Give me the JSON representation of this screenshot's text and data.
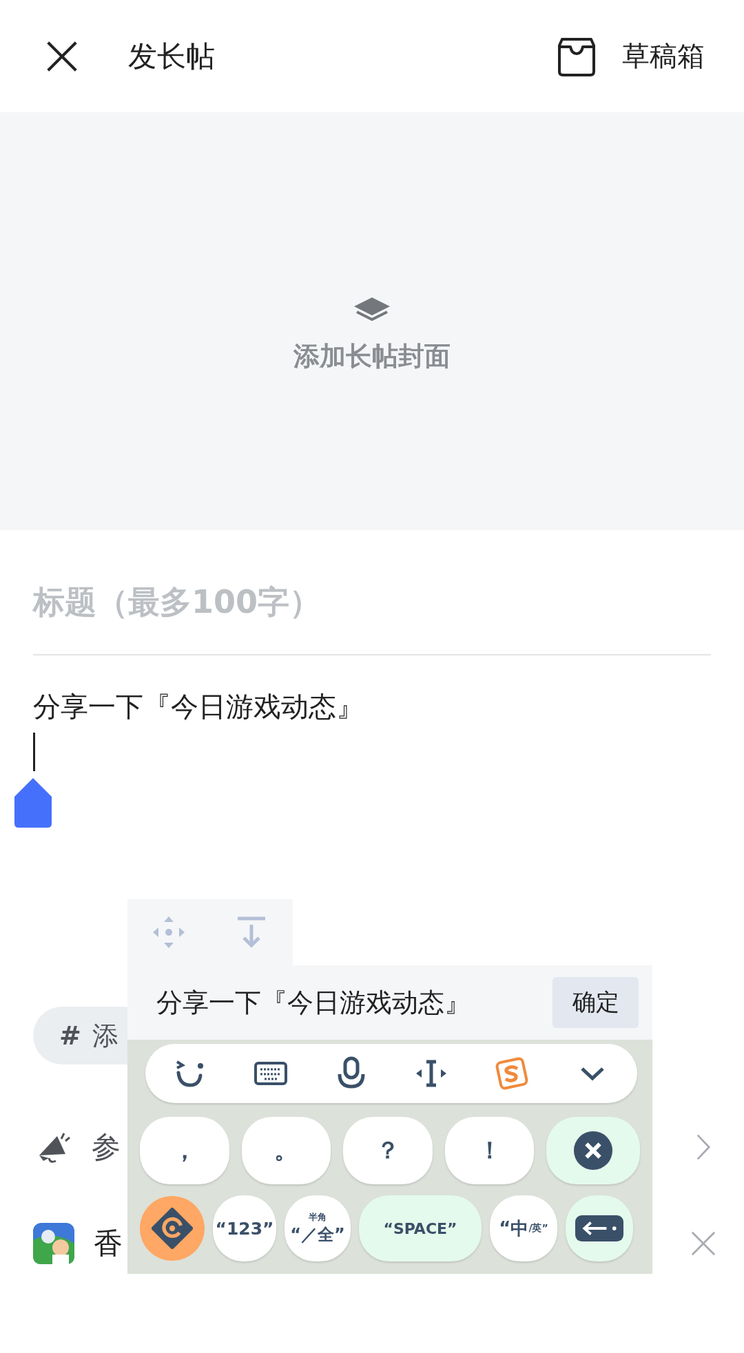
{
  "header": {
    "title": "发长帖",
    "drafts_label": "草稿箱"
  },
  "cover": {
    "label": "添加长帖封面"
  },
  "title_field": {
    "placeholder": "标题（最多100字）"
  },
  "body_field": {
    "value": "分享一下『今日游戏动态』"
  },
  "topic_tag": {
    "prefix": "#",
    "label": "添"
  },
  "rows": [
    {
      "kind": "activity",
      "label": "参"
    },
    {
      "kind": "game",
      "label": "香"
    }
  ],
  "keyboard": {
    "composition": "分享一下『今日游戏动态』",
    "confirm": "确定",
    "symbol_keys": [
      "，",
      "。",
      "？",
      "！"
    ],
    "bottom_keys": [
      {
        "kind": "number",
        "label": "“123”"
      },
      {
        "kind": "width",
        "small": "半角",
        "label": "“／全”"
      },
      {
        "kind": "space",
        "label": "“SPACE”"
      },
      {
        "kind": "language",
        "label": "“中",
        "small": "/英”"
      }
    ]
  }
}
